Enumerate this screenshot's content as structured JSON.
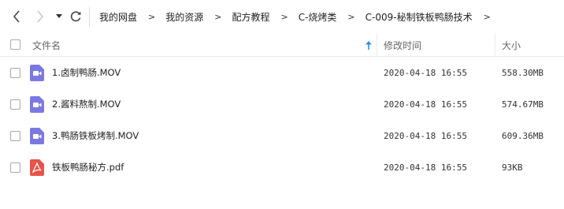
{
  "toolbar": {
    "back_icon": "chevron-left-icon",
    "forward_icon": "chevron-right-icon",
    "history_icon": "dropdown-arrow-icon",
    "refresh_icon": "refresh-icon"
  },
  "breadcrumb": {
    "items": [
      "我的网盘",
      "我的资源",
      "配方教程",
      "C-烧烤类",
      "C-009-秘制铁板鸭肠技术"
    ],
    "separator": ">"
  },
  "header": {
    "name": "文件名",
    "modified": "修改时间",
    "size": "大小",
    "sort_icon": "sort-ascending-icon"
  },
  "files": [
    {
      "name": "1.卤制鸭肠.MOV",
      "modified": "2020-04-18 16:55",
      "size": "558.30MB",
      "type": "video",
      "icon": "video-file-icon"
    },
    {
      "name": "2.酱料熬制.MOV",
      "modified": "2020-04-18 16:55",
      "size": "574.67MB",
      "type": "video",
      "icon": "video-file-icon"
    },
    {
      "name": "3.鸭肠铁板烤制.MOV",
      "modified": "2020-04-18 16:55",
      "size": "609.36MB",
      "type": "video",
      "icon": "video-file-icon"
    },
    {
      "name": "铁板鸭肠秘方.pdf",
      "modified": "2020-04-18 16:55",
      "size": "93KB",
      "type": "pdf",
      "icon": "pdf-file-icon"
    }
  ],
  "colors": {
    "video_icon": "#7b79e0",
    "pdf_icon": "#e8534b",
    "sort_arrow": "#2f8cf5",
    "disabled": "#c8c8c8"
  }
}
